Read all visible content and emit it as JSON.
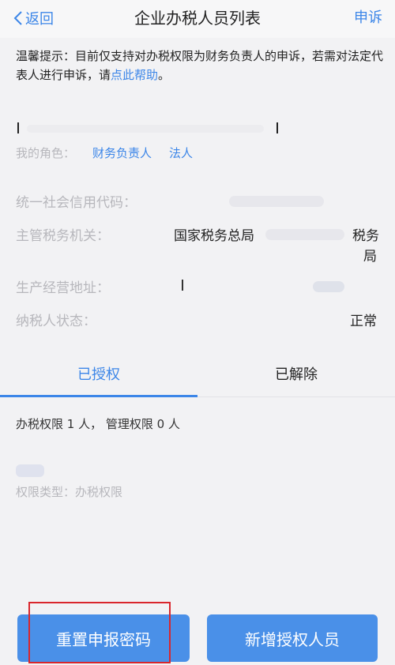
{
  "header": {
    "back_label": "返回",
    "title": "企业办税人员列表",
    "action_label": "申诉"
  },
  "notice": {
    "text": "温馨提示：目前仅支持对办税权限为财务负责人的申诉，若需对法定代表人进行申诉，请",
    "link": "点此帮助",
    "end": "。"
  },
  "company": {
    "role_label": "我的角色：",
    "roles": [
      "财务负责人",
      "法人"
    ],
    "credit_code_label": "统一社会信用代码：",
    "tax_authority_label": "主管税务机关：",
    "tax_authority_value": "国家税务总局",
    "tax_authority_suffix_1": "税务",
    "tax_authority_suffix_2": "局",
    "address_label": "生产经营地址：",
    "taxpayer_status_label": "纳税人状态：",
    "taxpayer_status_value": "正常"
  },
  "tabs": [
    {
      "label": "已授权",
      "active": true
    },
    {
      "label": "已解除",
      "active": false
    }
  ],
  "permissions": {
    "summary": "办税权限 1 人，  管理权限 0 人",
    "type_text": "权限类型：办税权限"
  },
  "buttons": {
    "reset_password": "重置申报密码",
    "add_person": "新增授权人员"
  },
  "colors": {
    "accent": "#3c86e8",
    "button": "#4a90e8",
    "highlight": "#d9262c",
    "muted_text": "#b7b7bc"
  }
}
